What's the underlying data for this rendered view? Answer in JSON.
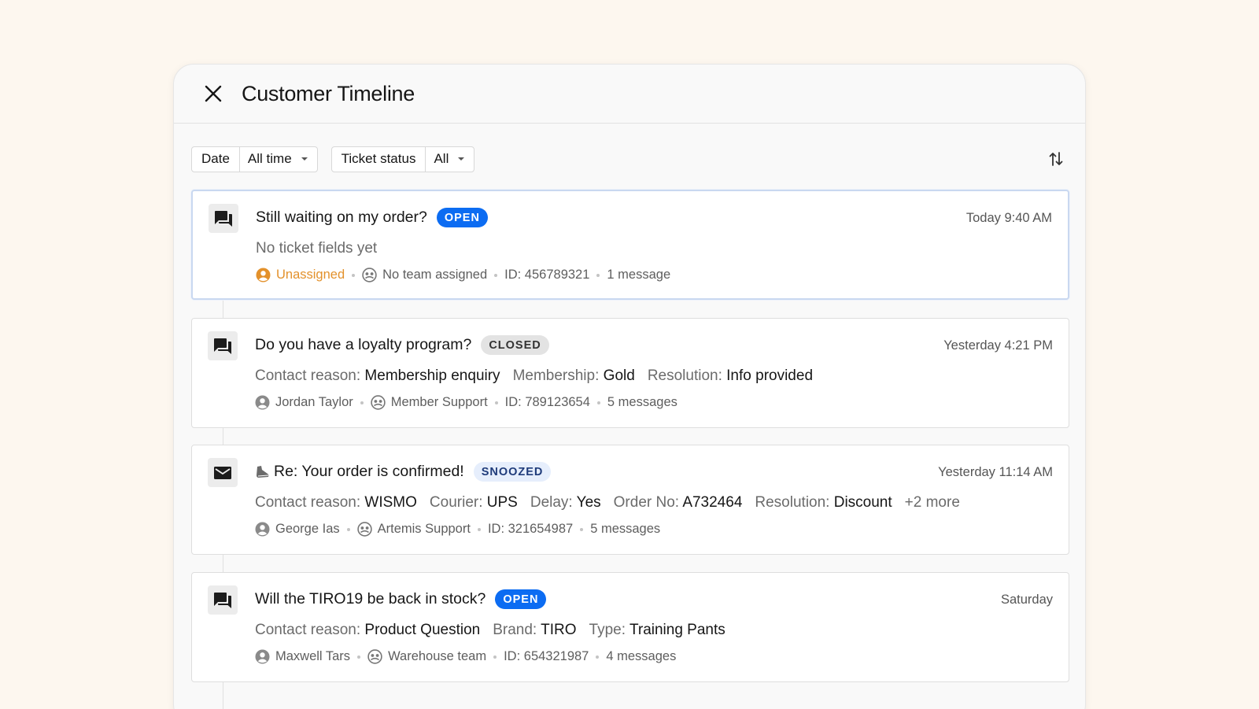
{
  "header": {
    "title": "Customer Timeline"
  },
  "filters": [
    {
      "label": "Date",
      "value": "All time"
    },
    {
      "label": "Ticket status",
      "value": "All"
    }
  ],
  "tickets": [
    {
      "icon": "chat-icon",
      "title": "Still waiting on my order?",
      "status": "OPEN",
      "time": "Today 9:40 AM",
      "empty_fields_text": "No ticket fields yet",
      "fields": [],
      "assignee": "Unassigned",
      "team": "No team assigned",
      "id": "ID: 456789321",
      "messages": "1 message"
    },
    {
      "icon": "chat-icon",
      "title": "Do you have a loyalty program?",
      "status": "CLOSED",
      "time": "Yesterday 4:21 PM",
      "fields": [
        {
          "key": "Contact reason:",
          "value": "Membership enquiry"
        },
        {
          "key": "Membership:",
          "value": "Gold"
        },
        {
          "key": "Resolution:",
          "value": "Info provided"
        }
      ],
      "assignee": "Jordan Taylor",
      "team": "Member Support",
      "id": "ID: 789123654",
      "messages": "5 messages"
    },
    {
      "icon": "email-icon",
      "title": "Re: Your order is confirmed!",
      "title_prefix_icon": "snooze-shoe-icon",
      "status": "SNOOZED",
      "time": "Yesterday 11:14 AM",
      "fields": [
        {
          "key": "Contact reason:",
          "value": "WISMO"
        },
        {
          "key": "Courier:",
          "value": "UPS"
        },
        {
          "key": "Delay:",
          "value": "Yes"
        },
        {
          "key": "Order No:",
          "value": "A732464"
        },
        {
          "key": "Resolution:",
          "value": "Discount"
        }
      ],
      "more": "+2 more",
      "assignee": "George Ias",
      "team": "Artemis Support",
      "id": "ID: 321654987",
      "messages": "5 messages"
    },
    {
      "icon": "chat-icon",
      "title": "Will the TIRO19 be back in stock?",
      "status": "OPEN",
      "time": "Saturday",
      "fields": [
        {
          "key": "Contact reason:",
          "value": "Product Question"
        },
        {
          "key": "Brand:",
          "value": "TIRO"
        },
        {
          "key": "Type:",
          "value": "Training Pants"
        }
      ],
      "assignee": "Maxwell Tars",
      "team": "Warehouse team",
      "id": "ID: 654321987",
      "messages": "4 messages"
    }
  ],
  "colors": {
    "background": "#fdf7ef",
    "badge_open": "#0c6cf2",
    "badge_closed": "#e3e3e3",
    "badge_snoozed": "#e6eefc",
    "unassigned": "#e3912b"
  }
}
